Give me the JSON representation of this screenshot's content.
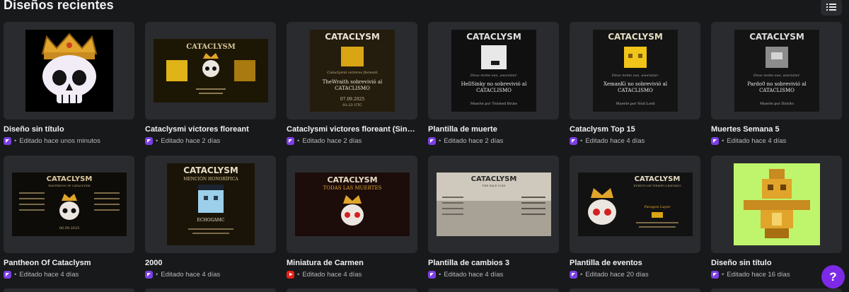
{
  "header": {
    "title": "Diseños recientes",
    "view_icon": "list-view-icon"
  },
  "designs": [
    {
      "name": "Diseño sin título",
      "edited": "Editado hace unos minutos",
      "badge": "canva",
      "thumb_icon": "skull-crown-thumbnail",
      "thumb_color": "#000000"
    },
    {
      "name": "Cataclysmi victores floreant",
      "edited": "Editado hace 2 días",
      "badge": "canva",
      "thumb_icon": "cataclysm-victors-thumbnail",
      "thumb_color": "#1c1605"
    },
    {
      "name": "Cataclysmi victores floreant (Single)",
      "edited": "Editado hace 2 días",
      "badge": "canva",
      "thumb_icon": "cataclysm-single-thumbnail",
      "thumb_color": "#241c0c",
      "thumb_text": {
        "headline": "CATACLYSM",
        "caption": "Cataclysmi victores floreant",
        "line1": "TheWraith sobrevivió al",
        "line2": "CATACLISMO",
        "date": "07.09.2025",
        "time": "01:23 UTC"
      }
    },
    {
      "name": "Plantilla de muerte",
      "edited": "Editado hace 2 días",
      "badge": "canva",
      "thumb_icon": "death-template-thumbnail",
      "thumb_color": "#101010",
      "thumb_text": {
        "headline": "CATACLYSM",
        "caption": "Deus nemo eas, asociatur.",
        "line1": "HellSinky no sobrevivió al",
        "line2": "CATACLISMO",
        "footer": "Muerte por Twisted Brute"
      }
    },
    {
      "name": "Cataclysm Top 15",
      "edited": "Editado hace 4 días",
      "badge": "canva",
      "thumb_icon": "top15-thumbnail",
      "thumb_color": "#141414",
      "thumb_text": {
        "headline": "CATACLYSM",
        "caption": "Deus nemo eas, asociatur.",
        "line1": "XemanKi no sobrevivió al",
        "line2": "CATACLISMO",
        "footer": "Muerte por Void Lord"
      }
    },
    {
      "name": "Muertes Semana 5",
      "edited": "Editado hace 4 días",
      "badge": "canva",
      "thumb_icon": "deaths-week5-thumbnail",
      "thumb_color": "#141414",
      "thumb_text": {
        "headline": "CATACLYSM",
        "caption": "Deus nemo eas, asociatur.",
        "line1": "Pardo0 no sobrevivió al",
        "line2": "CATACLISMO",
        "footer": "Muerte por Diorito"
      }
    },
    {
      "name": "Pantheon Of Cataclysm",
      "edited": "Editado hace 4 días",
      "badge": "canva",
      "thumb_icon": "pantheon-thumbnail",
      "thumb_color": "#0e0c08",
      "thumb_text": {
        "headline": "CATACLYSM",
        "caption": "PANTHEON OF CATACLYSM",
        "date": "06.09.2025"
      }
    },
    {
      "name": "2000",
      "edited": "Editado hace 4 días",
      "badge": "canva",
      "thumb_icon": "honorable-mention-thumbnail",
      "thumb_color": "#1a1408",
      "thumb_text": {
        "headline": "CATACLYSM",
        "caption": "MENCIÓN HONORÍFICA",
        "line1": "ECHOGAMC"
      }
    },
    {
      "name": "Miniatura de Carmen",
      "edited": "Editado hace 4 días",
      "badge": "youtube",
      "thumb_icon": "carmen-thumbnail",
      "thumb_color": "#1c0c0a",
      "thumb_text": {
        "headline": "CATACLYSM",
        "caption": "TODAS LAS MUERTES"
      }
    },
    {
      "name": "Plantilla de cambios 3",
      "edited": "Editado hace 4 días",
      "badge": "canva",
      "thumb_icon": "changes-template-thumbnail",
      "thumb_color": "#cfc8bc",
      "thumb_text": {
        "headline": "CATACLYSM",
        "caption": "THE PALE VOID"
      }
    },
    {
      "name": "Plantilla de eventos",
      "edited": "Editado hace 20 días",
      "badge": "canva",
      "thumb_icon": "events-template-thumbnail",
      "thumb_color": "#121212",
      "thumb_text": {
        "headline": "CATACLYSM",
        "caption": "EVENTO DE TIEMPO LIMITADO",
        "line1": "Paragon Layer"
      }
    },
    {
      "name": "Diseño sin título",
      "edited": "Editado hace 16 días",
      "badge": "canva",
      "thumb_icon": "golden-totem-thumbnail",
      "thumb_color": "#bff56c"
    }
  ],
  "help": {
    "label": "?",
    "icon": "help-icon"
  },
  "colors": {
    "background": "#18191b",
    "card": "#2a2b2e",
    "accent": "#7d2ae8",
    "gold": "#e0a52a",
    "youtube": "#e62117"
  }
}
